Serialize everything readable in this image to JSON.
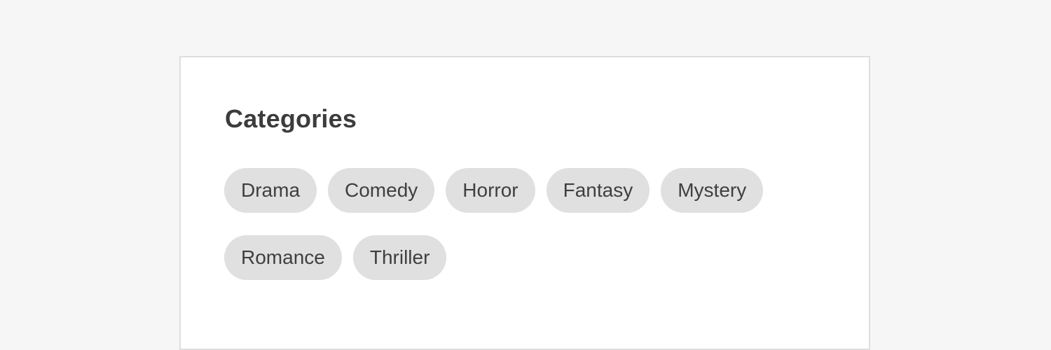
{
  "section": {
    "title": "Categories"
  },
  "tags": [
    {
      "label": "Drama"
    },
    {
      "label": "Comedy"
    },
    {
      "label": "Horror"
    },
    {
      "label": "Fantasy"
    },
    {
      "label": "Mystery"
    },
    {
      "label": "Romance"
    },
    {
      "label": "Thriller"
    }
  ],
  "colors": {
    "page_background": "#f6f6f6",
    "card_background": "#ffffff",
    "card_border": "#dedede",
    "tag_background": "#e0e0e0",
    "text": "#3c3c3c"
  }
}
